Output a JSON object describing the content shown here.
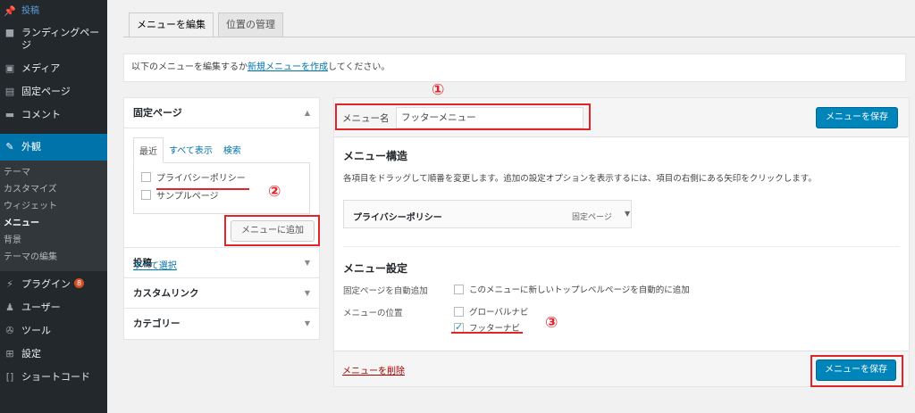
{
  "sidebar": {
    "items": [
      {
        "icon": "📌",
        "label": "投稿"
      },
      {
        "icon": "■",
        "label": "ランディングページ"
      },
      {
        "icon": "🖼",
        "label": "メディア"
      },
      {
        "icon": "▤",
        "label": "固定ページ"
      },
      {
        "icon": "💬",
        "label": "コメント"
      },
      {
        "icon": "🖌",
        "label": "外観"
      }
    ],
    "appearance_sub": [
      "テーマ",
      "カスタマイズ",
      "ウィジェット",
      "メニュー",
      "背景",
      "テーマの編集"
    ],
    "bottom_items": [
      {
        "icon": "🔌",
        "label": "プラグイン",
        "badge": "8"
      },
      {
        "icon": "👤",
        "label": "ユーザー"
      },
      {
        "icon": "🔧",
        "label": "ツール"
      },
      {
        "icon": "⊞",
        "label": "設定"
      },
      {
        "icon": "[]",
        "label": "ショートコード"
      }
    ]
  },
  "tabs": {
    "edit": "メニューを編集",
    "locations": "位置の管理"
  },
  "notice": {
    "prefix": "以下のメニューを編集するか",
    "link": "新規メニューを作成",
    "suffix": "してください。"
  },
  "left": {
    "pages_title": "固定ページ",
    "subtabs": [
      "最近",
      "すべて表示",
      "検索"
    ],
    "pages": [
      {
        "label": "プライバシーポリシー",
        "checked": false
      },
      {
        "label": "サンプルページ",
        "checked": false
      }
    ],
    "select_all": "すべて選択",
    "add_button": "メニューに追加",
    "sections": [
      "投稿",
      "カスタムリンク",
      "カテゴリー"
    ]
  },
  "right": {
    "menu_name_label": "メニュー名",
    "menu_name_value": "フッターメニュー",
    "save_button": "メニューを保存",
    "structure_title": "メニュー構造",
    "structure_desc": "各項目をドラッグして順番を変更します。追加の設定オプションを表示するには、項目の右側にある矢印をクリックします。",
    "menu_item": {
      "title": "プライバシーポリシー",
      "type": "固定ページ"
    },
    "settings_title": "メニュー設定",
    "auto_add_label": "固定ページを自動追加",
    "auto_add_option": "このメニューに新しいトップレベルページを自動的に追加",
    "location_label": "メニューの位置",
    "locations": [
      {
        "label": "グローバルナビ",
        "checked": false
      },
      {
        "label": "フッターナビ",
        "checked": true
      }
    ],
    "delete_link": "メニューを削除"
  },
  "annotations": {
    "a1": "①",
    "a2": "②",
    "a3": "③"
  },
  "colors": {
    "sidebar_bg": "#23282d",
    "accent": "#0073aa",
    "primary_button": "#0085ba",
    "highlight": "#e0242a"
  }
}
